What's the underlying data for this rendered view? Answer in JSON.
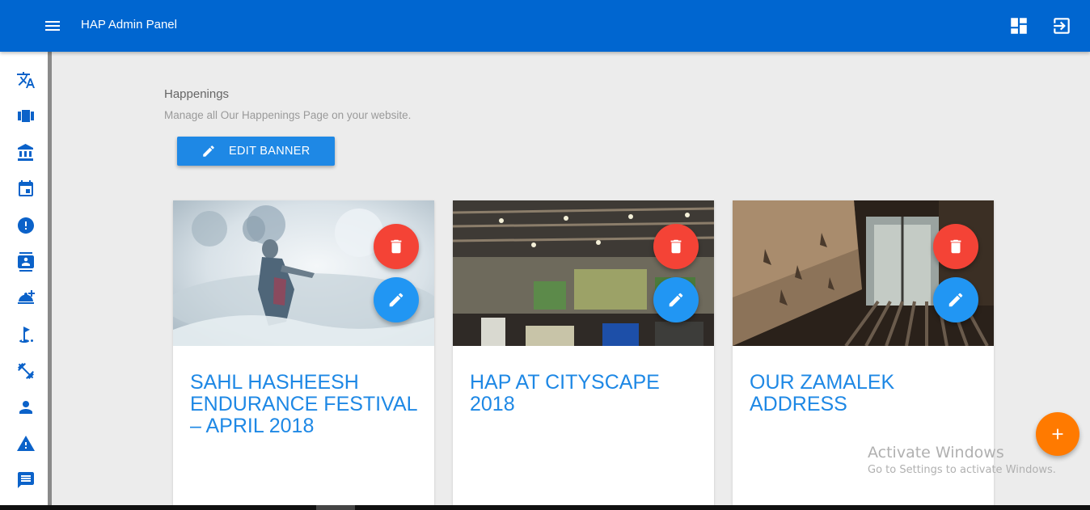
{
  "app": {
    "title": "HAP Admin Panel"
  },
  "topbar": {
    "menu_icon": "menu-icon",
    "dashboard_icon": "dashboard-icon",
    "logout_icon": "exit-to-app-icon"
  },
  "sidebar": {
    "items": [
      {
        "icon": "translate-icon"
      },
      {
        "icon": "view-carousel-icon"
      },
      {
        "icon": "account-balance-icon"
      },
      {
        "icon": "event-icon"
      },
      {
        "icon": "error-icon"
      },
      {
        "icon": "contacts-icon"
      },
      {
        "icon": "room-service-icon"
      },
      {
        "icon": "golf-course-icon"
      },
      {
        "icon": "fitness-center-icon"
      },
      {
        "icon": "person-icon"
      },
      {
        "icon": "warning-icon"
      },
      {
        "icon": "message-icon"
      }
    ]
  },
  "page": {
    "title": "Happenings",
    "subtitle": "Manage all Our Happenings Page on your website.",
    "edit_banner_label": "EDIT BANNER"
  },
  "cards": [
    {
      "title": "SAHL HASHEESH ENDURANCE FESTIVAL – APRIL 2018"
    },
    {
      "title": "HAP AT CITYSCAPE 2018"
    },
    {
      "title": "OUR ZAMALEK ADDRESS"
    }
  ],
  "watermark": {
    "line1": "Activate Windows",
    "line2": "Go to Settings to activate Windows."
  },
  "colors": {
    "primary": "#0066d0",
    "accent_blue": "#1e88e5",
    "delete_red": "#f44336",
    "add_orange": "#ff7a00"
  }
}
